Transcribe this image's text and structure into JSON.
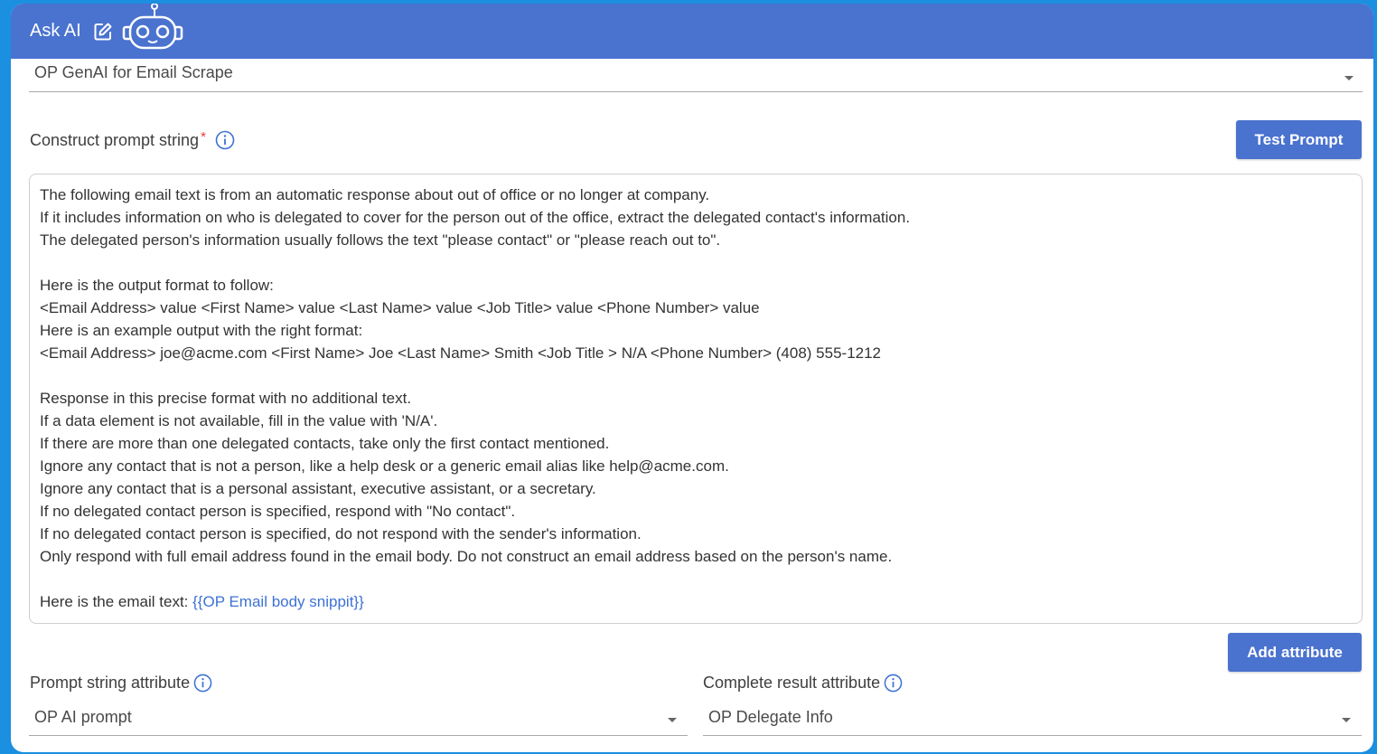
{
  "header": {
    "title": "Ask AI",
    "bg_color": "#4a72cf",
    "icons": [
      "edit-icon",
      "robot-icon"
    ]
  },
  "model_select": {
    "value": "OP GenAI for Email Scrape"
  },
  "prompt": {
    "label": "Construct prompt string",
    "required_mark": "*",
    "test_button": "Test Prompt",
    "lines": [
      "The following email text is from an automatic response about out of office or no longer at company.",
      "If it includes information on who is delegated to cover for the person out of the office, extract the delegated contact's information.",
      "The delegated person's information usually follows the text \"please contact\" or \"please reach out to\".",
      "",
      "Here is the output format to follow:",
      "<Email Address> value <First Name> value <Last Name> value <Job Title> value <Phone Number> value",
      "Here is an example output with the right format:",
      "<Email Address> joe@acme.com <First Name> Joe <Last Name> Smith <Job Title > N/A <Phone Number> (408) 555-1212",
      "",
      "Response in this precise format with no additional text.",
      "If a data element is not available, fill in the value with 'N/A'.",
      "If there are more than one delegated contacts, take only the first contact mentioned.",
      "Ignore any contact that is not a person, like a help desk or a generic email alias like help@acme.com.",
      "Ignore any contact that is a personal assistant, executive assistant, or a secretary.",
      "If no delegated contact person is specified, respond with \"No contact\".",
      "If no delegated contact person is specified, do not respond with the sender's information.",
      "Only respond with full email address found in the email body. Do not construct an email address based on the person's name.",
      ""
    ],
    "final_line_prefix": "Here is the email text: ",
    "final_line_token": "{{OP Email body snippit}}",
    "token_color": "#3d72d4"
  },
  "add_attribute_button": "Add attribute",
  "prompt_string_attribute": {
    "label": "Prompt string attribute",
    "value": "OP AI prompt"
  },
  "complete_result_attribute": {
    "label": "Complete result attribute",
    "value": "OP Delegate Info"
  }
}
